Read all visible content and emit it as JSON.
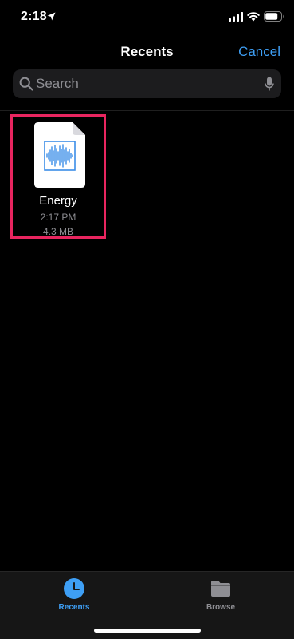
{
  "status_bar": {
    "time": "2:18",
    "icons": [
      "location-arrow-icon",
      "cellular-signal-icon",
      "wifi-icon",
      "battery-icon"
    ]
  },
  "nav": {
    "title": "Recents",
    "cancel_label": "Cancel"
  },
  "search": {
    "placeholder": "Search",
    "value": ""
  },
  "files": [
    {
      "name": "Energy",
      "time": "2:17 PM",
      "size": "4.3 MB",
      "icon": "audio-waveform-document-icon",
      "selected": true
    }
  ],
  "tab_bar": {
    "tabs": [
      {
        "label": "Recents",
        "icon": "clock-icon",
        "active": true
      },
      {
        "label": "Browse",
        "icon": "folder-icon",
        "active": false
      }
    ]
  },
  "colors": {
    "accent": "#3e9ff5",
    "highlight": "#e8255f",
    "background": "#000000",
    "search_background": "#1c1c1e",
    "secondary_text": "#8e8e93"
  }
}
